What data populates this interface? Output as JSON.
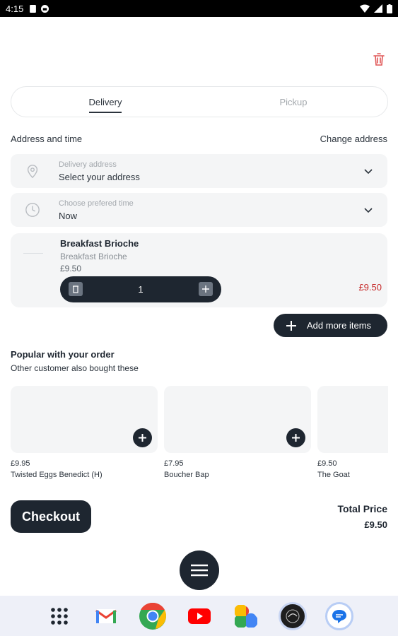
{
  "status_bar": {
    "time": "4:15"
  },
  "tabs": [
    {
      "label": "Delivery",
      "active": true
    },
    {
      "label": "Pickup",
      "active": false
    }
  ],
  "address_section": {
    "title": "Address and time",
    "change_link": "Change address",
    "address_field": {
      "label": "Delivery address",
      "value": "Select your address"
    },
    "time_field": {
      "label": "Choose prefered time",
      "value": "Now"
    }
  },
  "cart_item": {
    "name": "Breakfast Brioche",
    "description": "Breakfast Brioche",
    "unit_price": "£9.50",
    "quantity": "1",
    "line_total": "£9.50"
  },
  "add_more_label": "Add more items",
  "popular": {
    "title": "Popular with your order",
    "subtitle": "Other customer also bought these",
    "products": [
      {
        "price": "£9.95",
        "name": "Twisted Eggs Benedict (H)"
      },
      {
        "price": "£7.95",
        "name": "Boucher Bap"
      },
      {
        "price": "£9.50",
        "name": "The Goat"
      }
    ]
  },
  "footer": {
    "checkout_label": "Checkout",
    "total_label": "Total Price",
    "total_value": "£9.50"
  },
  "colors": {
    "primary": "#1e2630",
    "danger": "#c62828",
    "surface": "#f4f5f6"
  }
}
